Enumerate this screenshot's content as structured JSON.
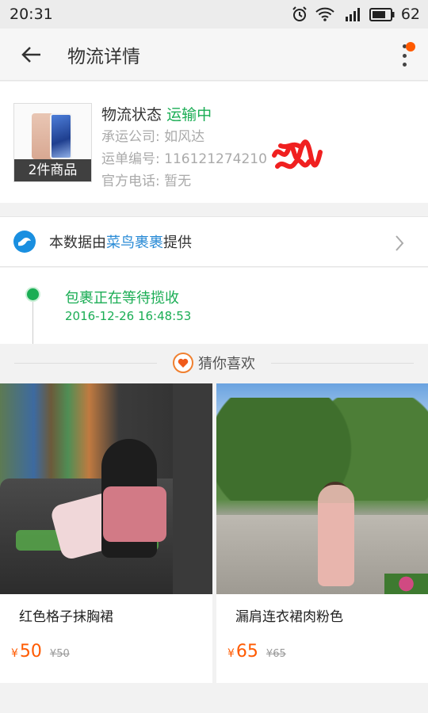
{
  "status_bar": {
    "time": "20:31",
    "battery": "62"
  },
  "header": {
    "title": "物流详情"
  },
  "package": {
    "thumb_label": "2件商品",
    "status_label": "物流状态",
    "status_value": "运输中",
    "carrier": "承运公司: 如风达",
    "tracking": "运单编号: 116121274210",
    "phone": "官方电话: 暂无"
  },
  "provider": {
    "prefix": "本数据由",
    "brand": "菜鸟裹裹",
    "suffix": "提供"
  },
  "tracking_event": {
    "text": "包裹正在等待揽收",
    "time": "2016-12-26 16:48:53"
  },
  "recommend": {
    "title": "猜你喜欢",
    "items": [
      {
        "name": "红色格子抹胸裙",
        "yen": "¥",
        "price": "50",
        "old_price": "¥50"
      },
      {
        "name": "漏肩连衣裙肉粉色",
        "yen": "¥",
        "price": "65",
        "old_price": "¥65"
      }
    ]
  },
  "colors": {
    "accent_green": "#1aad54",
    "link_blue": "#2a8bd6",
    "price_orange": "#ff5a00"
  }
}
